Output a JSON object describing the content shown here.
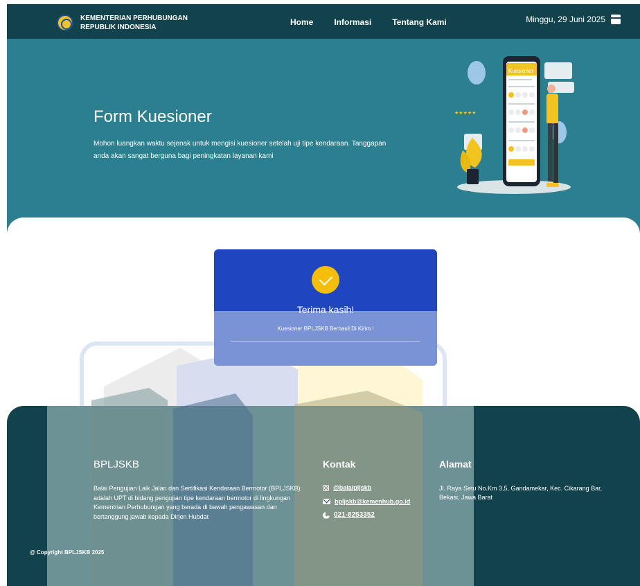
{
  "header": {
    "org_line1": "KEMENTERIAN PERHUBUNGAN",
    "org_line2": "REPUBLIK INDONESIA",
    "nav": [
      "Home",
      "Informasi",
      "Tentang Kami"
    ],
    "date": "Minggu, 29 Juni 2025",
    "date_icon": "calendar-icon"
  },
  "hero": {
    "title": "Form Kuesioner",
    "text": "Mohon luangkan waktu sejenak untuk mengisi kuesioner setelah uji tipe kendaraan. Tanggapan anda akan sangat berguna bagi peningkatan layanan kami",
    "illustration_title": "Kuesioner"
  },
  "card": {
    "title": "Terima kasih!",
    "message": "Kuesioner BPLJSKB Berhasil Di Kirim !",
    "icon": "check-icon"
  },
  "footer": {
    "brand": "BPLJSKB",
    "description": "Balai Pengujian Laik Jalan dan Sertifikasi Kendaraan Bermotor (BPLJSKB) adalah UPT di bidang pengujian tipe kendaraan bermotor di lingkungan Kementrian Perhubungan yang berada di bawah pengawasan dan bertanggung jawab kepada Dirjen Hubdat",
    "kontak_title": "Kontak",
    "instagram": "@balaipljskb",
    "email": "bpljskb@kemenhub.go.id",
    "phone": "021-8253352",
    "alamat_title": "Alamat",
    "address": "Jl. Raya Setu No.Km 3,5, Gandamekar, Kec. Cikarang Bar, Bekasi, Jawa Barat",
    "copyright": "@ Copyright BPLJSKB 2025"
  },
  "colors": {
    "header_bg": "#12424c",
    "hero_bg": "#2b7f8f",
    "card_blue": "#1f45bf",
    "card_lower": "#7a93d6",
    "check_yellow": "#f5be0b",
    "footer_panel": "#6d9295"
  }
}
